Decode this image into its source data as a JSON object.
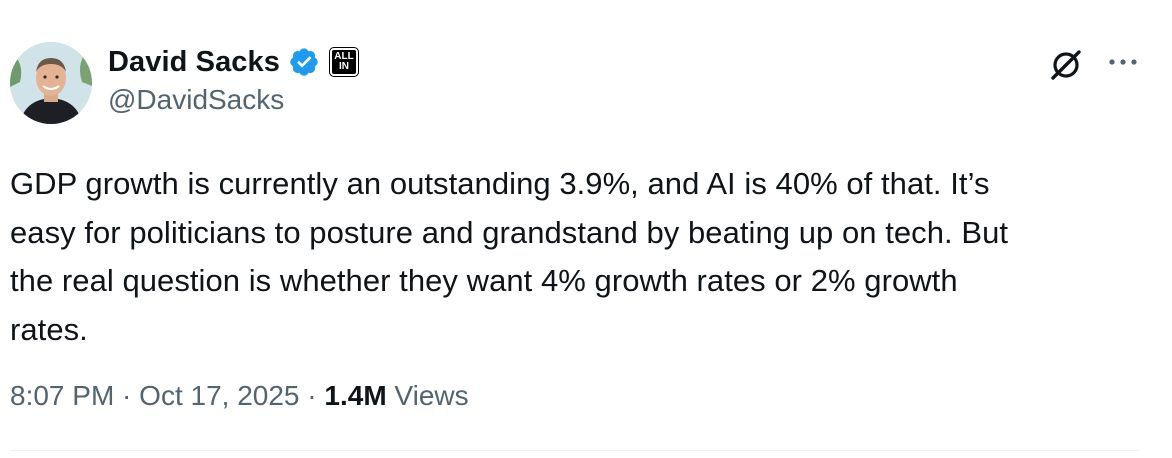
{
  "author": {
    "display_name": "David Sacks",
    "handle": "@DavidSacks",
    "affiliate_badge": "ALL IN",
    "verified_color": "#1d9bf0"
  },
  "tweet": {
    "text": "GDP growth is currently an outstanding 3.9%, and AI is 40% of that. It’s\neasy for politicians to posture and grandstand by beating up on tech. But\nthe real question is whether they want 4% growth rates or 2% growth\nrates.",
    "time": "8:07 PM",
    "date": "Oct 17, 2025",
    "separator": " · ",
    "views_count": "1.4M",
    "views_label": " Views"
  },
  "icons": {
    "grok": "grok-icon",
    "more": "more-options-icon",
    "verified": "verified-badge-icon"
  },
  "colors": {
    "text_primary": "#0f1419",
    "text_secondary": "#536471",
    "divider": "#eff3f4"
  }
}
